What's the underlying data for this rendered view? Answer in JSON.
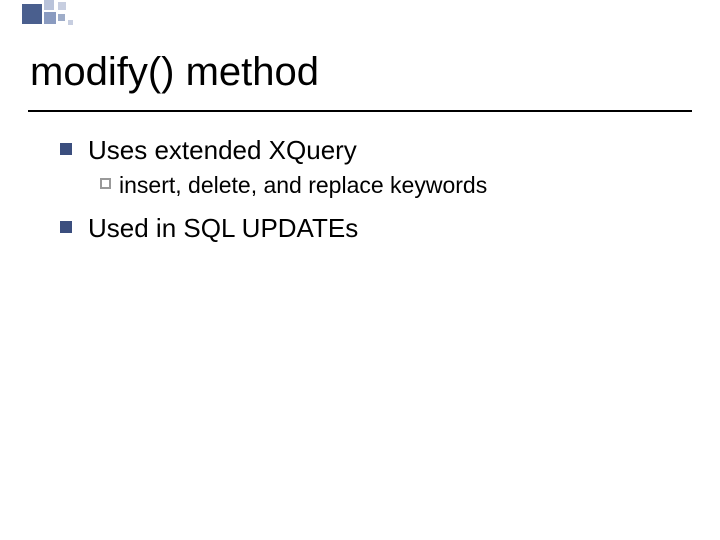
{
  "title": "modify() method",
  "bullets": [
    {
      "text": "Uses extended XQuery",
      "children": [
        {
          "text": "insert, delete, and replace keywords"
        }
      ]
    },
    {
      "text": "Used in SQL UPDATEs",
      "children": []
    }
  ]
}
